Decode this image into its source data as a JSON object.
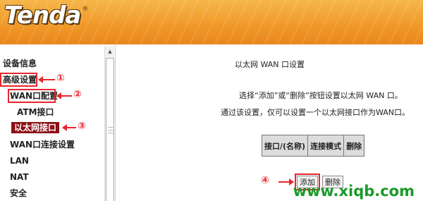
{
  "brand": {
    "logo_text": "Tenda",
    "reg_mark": "®"
  },
  "sidebar": {
    "items": [
      {
        "label": "设备信息"
      },
      {
        "label": "高级设置"
      },
      {
        "label": "WAN口配置"
      },
      {
        "label": "ATM接口"
      },
      {
        "label": "以太网接口"
      },
      {
        "label": "WAN口连接设置"
      },
      {
        "label": "LAN"
      },
      {
        "label": "NAT"
      },
      {
        "label": "安全"
      }
    ]
  },
  "annotations": {
    "n1": "①",
    "n2": "②",
    "n3": "③",
    "n4": "④"
  },
  "main": {
    "title": "以太网 WAN 口设置",
    "desc1": "选择“添加”或“删除”按钮设置以太网 WAN 口。",
    "desc2": "通过该设置，仅可以设置一个以太网接口作为WAN口。",
    "table_headers": [
      "接口/(名称)",
      "连接模式",
      "删除"
    ],
    "add_label": "添加",
    "delete_label": "删除"
  },
  "watermark": "www.xiqb.com",
  "colors": {
    "annotation": "#e8262c",
    "selected": "#8b1015",
    "header": "#f19a2a",
    "watermark": "#1a9a28"
  }
}
